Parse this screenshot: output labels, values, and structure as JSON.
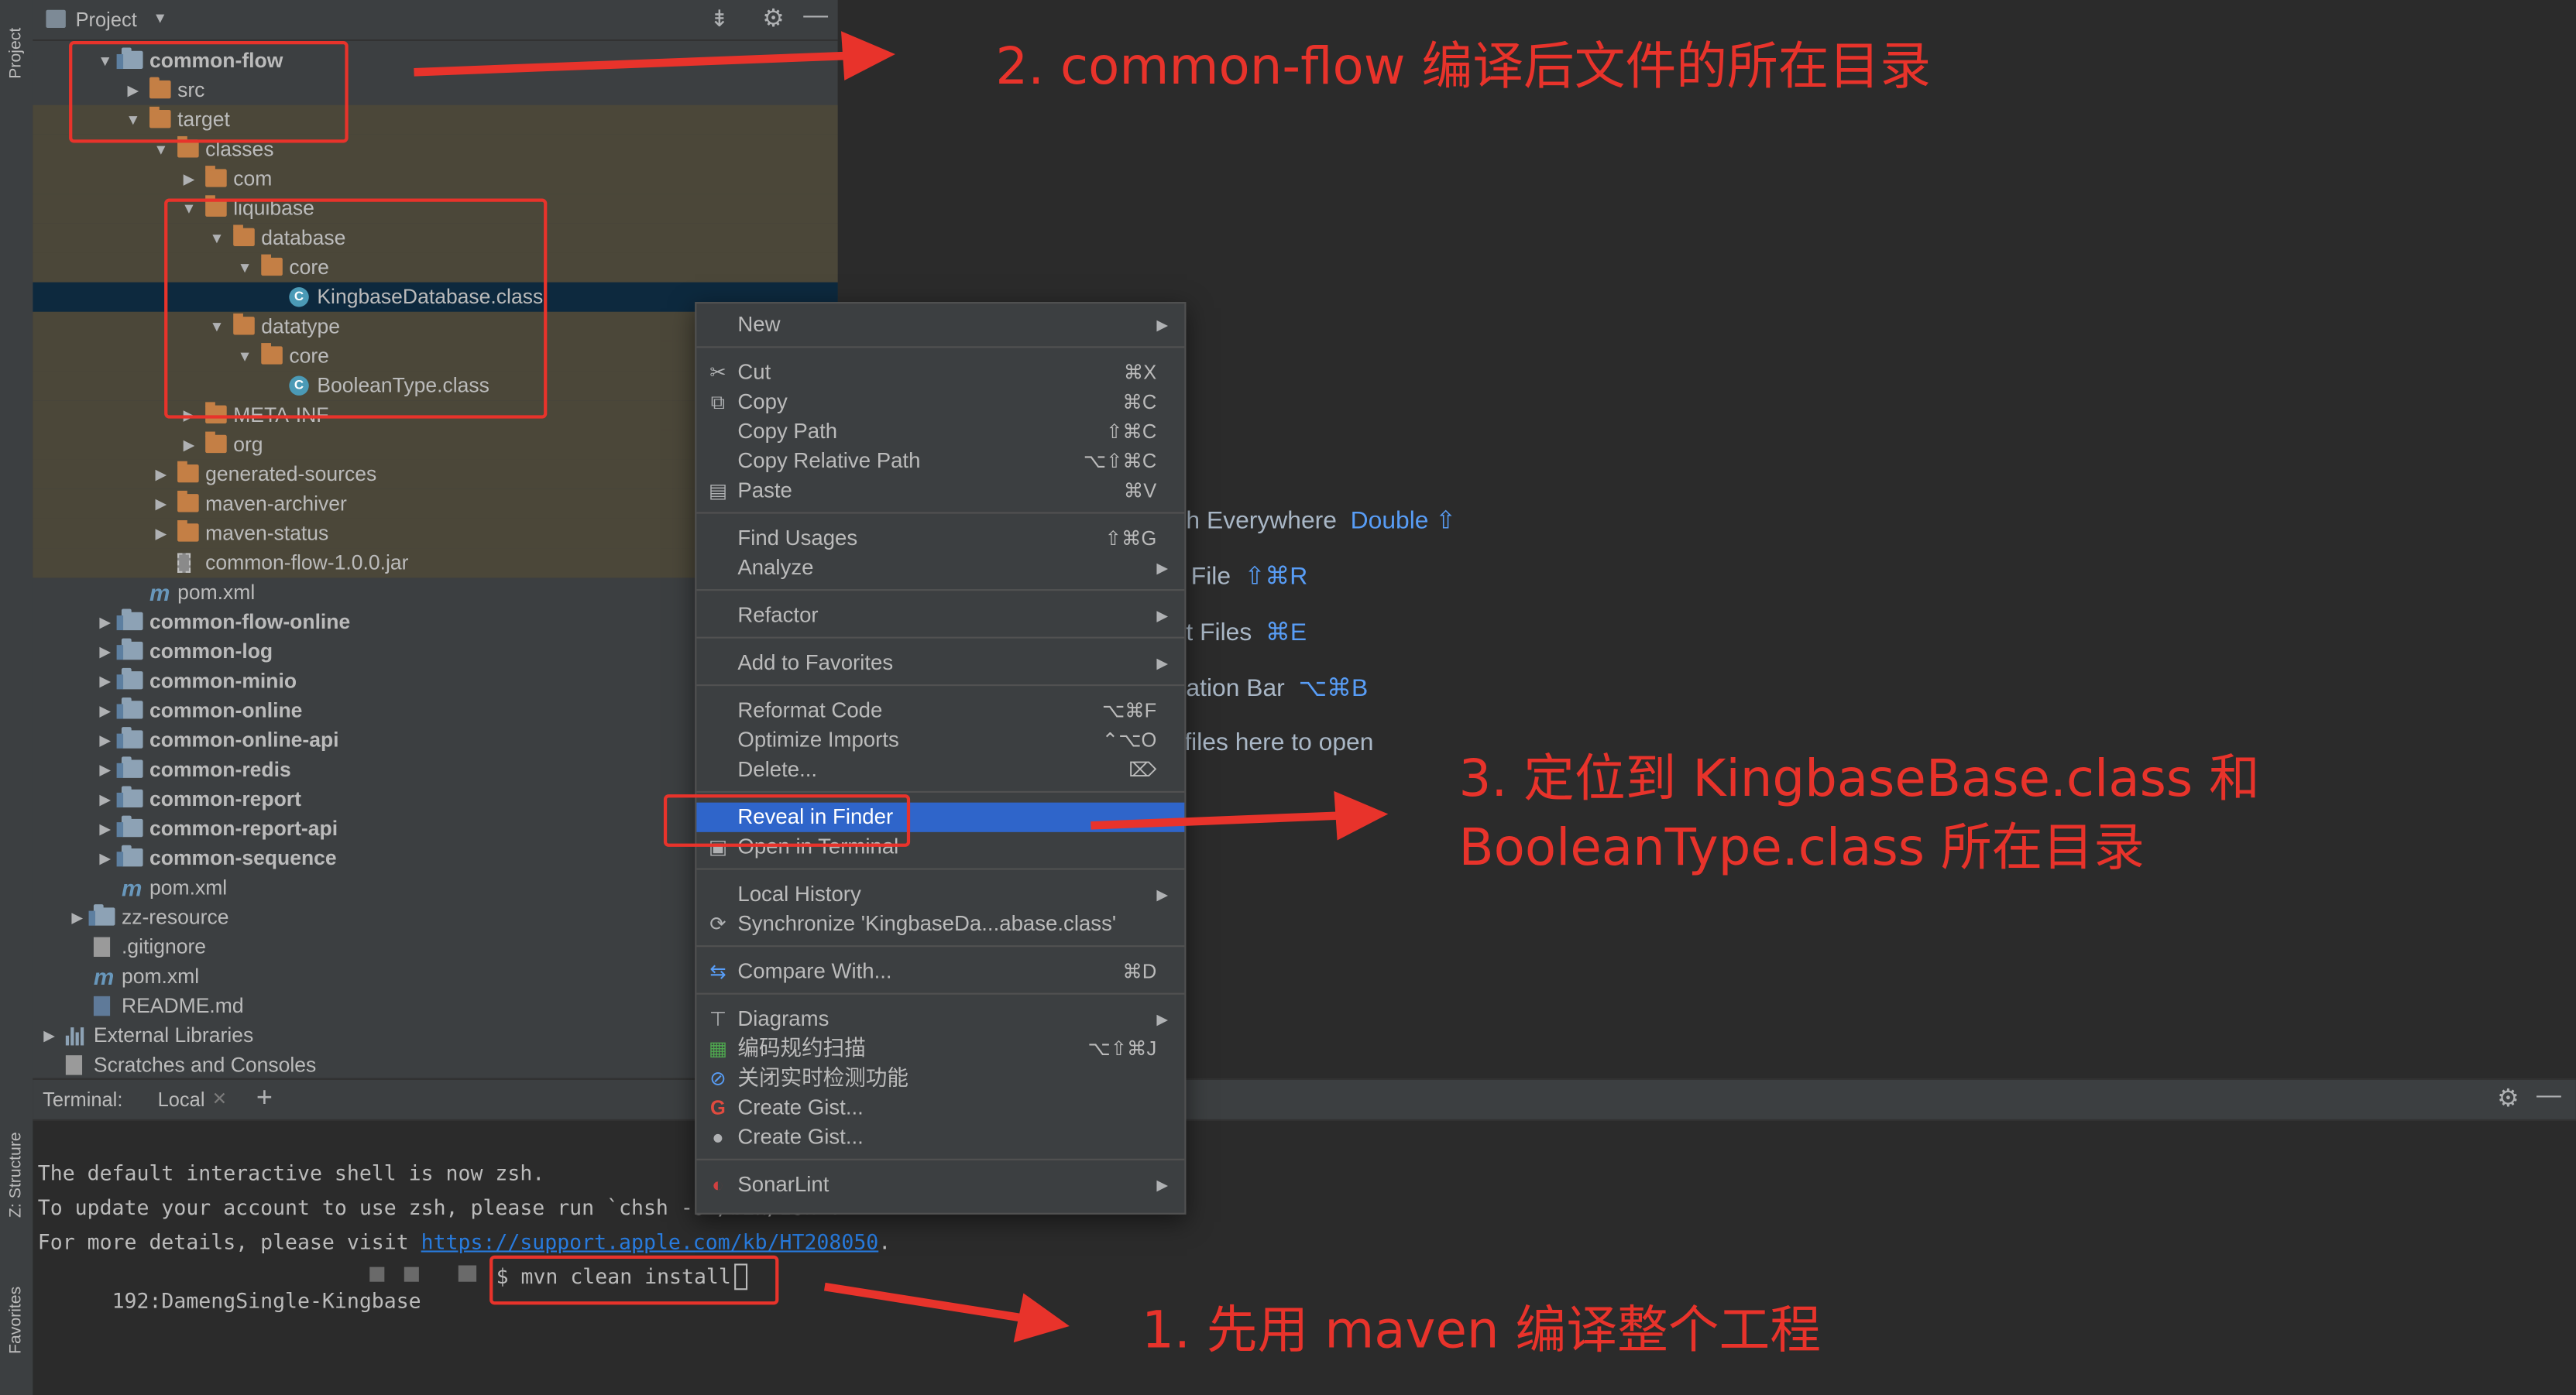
{
  "left_strip": {
    "tabs": [
      "Project",
      "Z: Structure",
      "Favorites"
    ]
  },
  "project_panel": {
    "title": "Project",
    "tree": [
      {
        "label": "common-flow",
        "indent": 2,
        "arrow": "open",
        "icon": "module-folder",
        "bold": true,
        "excluded": false
      },
      {
        "label": "src",
        "indent": 3,
        "arrow": "closed",
        "icon": "folder",
        "bold": false,
        "excluded": false
      },
      {
        "label": "target",
        "indent": 3,
        "arrow": "open",
        "icon": "folder-orange",
        "bold": false,
        "excluded": true
      },
      {
        "label": "classes",
        "indent": 4,
        "arrow": "open",
        "icon": "folder-orange",
        "bold": false,
        "excluded": true
      },
      {
        "label": "com",
        "indent": 5,
        "arrow": "closed",
        "icon": "folder-orange",
        "bold": false,
        "excluded": true
      },
      {
        "label": "liquibase",
        "indent": 5,
        "arrow": "open",
        "icon": "folder-orange",
        "bold": false,
        "excluded": true
      },
      {
        "label": "database",
        "indent": 6,
        "arrow": "open",
        "icon": "folder-orange",
        "bold": false,
        "excluded": true
      },
      {
        "label": "core",
        "indent": 7,
        "arrow": "open",
        "icon": "folder-orange",
        "bold": false,
        "excluded": true
      },
      {
        "label": "KingbaseDatabase.class",
        "indent": 8,
        "arrow": "none",
        "icon": "class",
        "bold": false,
        "excluded": false,
        "selected": true
      },
      {
        "label": "datatype",
        "indent": 6,
        "arrow": "open",
        "icon": "folder-orange",
        "bold": false,
        "excluded": true
      },
      {
        "label": "core",
        "indent": 7,
        "arrow": "open",
        "icon": "folder-orange",
        "bold": false,
        "excluded": true
      },
      {
        "label": "BooleanType.class",
        "indent": 8,
        "arrow": "none",
        "icon": "class",
        "bold": false,
        "excluded": true
      },
      {
        "label": "META-INF",
        "indent": 5,
        "arrow": "closed",
        "icon": "folder-orange",
        "bold": false,
        "excluded": true
      },
      {
        "label": "org",
        "indent": 5,
        "arrow": "closed",
        "icon": "folder-orange",
        "bold": false,
        "excluded": true
      },
      {
        "label": "generated-sources",
        "indent": 4,
        "arrow": "closed",
        "icon": "folder-orange",
        "bold": false,
        "excluded": true
      },
      {
        "label": "maven-archiver",
        "indent": 4,
        "arrow": "closed",
        "icon": "folder-orange",
        "bold": false,
        "excluded": true
      },
      {
        "label": "maven-status",
        "indent": 4,
        "arrow": "closed",
        "icon": "folder-orange",
        "bold": false,
        "excluded": true
      },
      {
        "label": "common-flow-1.0.0.jar",
        "indent": 4,
        "arrow": "none",
        "icon": "jar",
        "bold": false,
        "excluded": true
      },
      {
        "label": "pom.xml",
        "indent": 3,
        "arrow": "none",
        "icon": "maven",
        "bold": false,
        "excluded": false
      },
      {
        "label": "common-flow-online",
        "indent": 2,
        "arrow": "closed",
        "icon": "module-folder",
        "bold": true,
        "excluded": false
      },
      {
        "label": "common-log",
        "indent": 2,
        "arrow": "closed",
        "icon": "module-folder",
        "bold": true,
        "excluded": false
      },
      {
        "label": "common-minio",
        "indent": 2,
        "arrow": "closed",
        "icon": "module-folder",
        "bold": true,
        "excluded": false
      },
      {
        "label": "common-online",
        "indent": 2,
        "arrow": "closed",
        "icon": "module-folder",
        "bold": true,
        "excluded": false
      },
      {
        "label": "common-online-api",
        "indent": 2,
        "arrow": "closed",
        "icon": "module-folder",
        "bold": true,
        "excluded": false
      },
      {
        "label": "common-redis",
        "indent": 2,
        "arrow": "closed",
        "icon": "module-folder",
        "bold": true,
        "excluded": false
      },
      {
        "label": "common-report",
        "indent": 2,
        "arrow": "closed",
        "icon": "module-folder",
        "bold": true,
        "excluded": false
      },
      {
        "label": "common-report-api",
        "indent": 2,
        "arrow": "closed",
        "icon": "module-folder",
        "bold": true,
        "excluded": false
      },
      {
        "label": "common-sequence",
        "indent": 2,
        "arrow": "closed",
        "icon": "module-folder",
        "bold": true,
        "excluded": false
      },
      {
        "label": "pom.xml",
        "indent": 2,
        "arrow": "none",
        "icon": "maven",
        "bold": false,
        "excluded": false
      },
      {
        "label": "zz-resource",
        "indent": 1,
        "arrow": "closed",
        "icon": "module-folder",
        "bold": false,
        "excluded": false
      },
      {
        "label": ".gitignore",
        "indent": 1,
        "arrow": "none",
        "icon": "git-file",
        "bold": false,
        "excluded": false
      },
      {
        "label": "pom.xml",
        "indent": 1,
        "arrow": "none",
        "icon": "maven",
        "bold": false,
        "excluded": false
      },
      {
        "label": "README.md",
        "indent": 1,
        "arrow": "none",
        "icon": "md-file",
        "bold": false,
        "excluded": false
      },
      {
        "label": "External Libraries",
        "indent": 0,
        "arrow": "closed",
        "icon": "libraries",
        "bold": false,
        "excluded": false
      },
      {
        "label": "Scratches and Consoles",
        "indent": 0,
        "arrow": "none",
        "icon": "scratches",
        "bold": false,
        "excluded": false
      }
    ]
  },
  "editor_hints": [
    {
      "text": "h Everywhere",
      "key": "Double ⇧"
    },
    {
      "text": "File",
      "key": "⇧⌘R"
    },
    {
      "text": "t Files",
      "key": "⌘E"
    },
    {
      "text": "ation Bar",
      "key": "⌥⌘B"
    },
    {
      "text": "files here to open",
      "key": ""
    }
  ],
  "context_menu": {
    "items": [
      {
        "label": "New",
        "shortcut": "",
        "submenu": true,
        "icon": ""
      },
      {
        "sep": true
      },
      {
        "label": "Cut",
        "shortcut": "⌘X",
        "submenu": false,
        "icon": "✂"
      },
      {
        "label": "Copy",
        "shortcut": "⌘C",
        "submenu": false,
        "icon": "⧉"
      },
      {
        "label": "Copy Path",
        "shortcut": "⇧⌘C",
        "submenu": false,
        "icon": ""
      },
      {
        "label": "Copy Relative Path",
        "shortcut": "⌥⇧⌘C",
        "submenu": false,
        "icon": ""
      },
      {
        "label": "Paste",
        "shortcut": "⌘V",
        "submenu": false,
        "icon": "▤"
      },
      {
        "sep": true
      },
      {
        "label": "Find Usages",
        "shortcut": "⇧⌘G",
        "submenu": false,
        "icon": ""
      },
      {
        "label": "Analyze",
        "shortcut": "",
        "submenu": true,
        "icon": ""
      },
      {
        "sep": true
      },
      {
        "label": "Refactor",
        "shortcut": "",
        "submenu": true,
        "icon": ""
      },
      {
        "sep": true
      },
      {
        "label": "Add to Favorites",
        "shortcut": "",
        "submenu": true,
        "icon": ""
      },
      {
        "sep": true
      },
      {
        "label": "Reformat Code",
        "shortcut": "⌥⌘F",
        "submenu": false,
        "icon": ""
      },
      {
        "label": "Optimize Imports",
        "shortcut": "⌃⌥O",
        "submenu": false,
        "icon": ""
      },
      {
        "label": "Delete...",
        "shortcut": "⌦",
        "submenu": false,
        "icon": ""
      },
      {
        "sep": true
      },
      {
        "label": "Reveal in Finder",
        "shortcut": "",
        "submenu": false,
        "icon": "",
        "active": true
      },
      {
        "label": "Open in Terminal",
        "shortcut": "",
        "submenu": false,
        "icon": "▣"
      },
      {
        "sep": true
      },
      {
        "label": "Local History",
        "shortcut": "",
        "submenu": true,
        "icon": ""
      },
      {
        "label": "Synchronize 'KingbaseDa...abase.class'",
        "shortcut": "",
        "submenu": false,
        "icon": "⟳"
      },
      {
        "sep": true
      },
      {
        "label": "Compare With...",
        "shortcut": "⌘D",
        "submenu": false,
        "icon": "⇆"
      },
      {
        "sep": true
      },
      {
        "label": "Diagrams",
        "shortcut": "",
        "submenu": true,
        "icon": "⊤"
      },
      {
        "label": "编码规约扫描",
        "shortcut": "⌥⇧⌘J",
        "submenu": false,
        "icon": "▦"
      },
      {
        "label": "关闭实时检测功能",
        "shortcut": "",
        "submenu": false,
        "icon": "⊘"
      },
      {
        "label": "Create Gist...",
        "shortcut": "",
        "submenu": false,
        "icon": "G"
      },
      {
        "label": "Create Gist...",
        "shortcut": "",
        "submenu": false,
        "icon": "●"
      },
      {
        "sep": true
      },
      {
        "label": "SonarLint",
        "shortcut": "",
        "submenu": true,
        "icon": "◐"
      }
    ]
  },
  "terminal": {
    "title": "Terminal:",
    "tab": "Local",
    "lines": [
      "The default interactive shell is now zsh.",
      "To update your account to use zsh, please run `chsh -s /bin/zsh`."
    ],
    "details_prefix": "For more details, please visit ",
    "details_link": "https://support.apple.com/kb/HT208050",
    "details_suffix": ".",
    "prompt": "192:DamengSingle-Kingbase",
    "command": "$ mvn clean install"
  },
  "annotations": {
    "step1": "1. 先用 maven 编译整个工程",
    "step2": "2. common-flow 编译后文件的所在目录",
    "step3_line1": "3. 定位到 KingbaseBase.class 和",
    "step3_line2": "BooleanType.class 所在目录"
  },
  "colors": {
    "accent": "#2f65ca",
    "annotation_red": "#e8332b",
    "panel_bg": "#3c3f41",
    "editor_bg": "#2b2b2b"
  }
}
